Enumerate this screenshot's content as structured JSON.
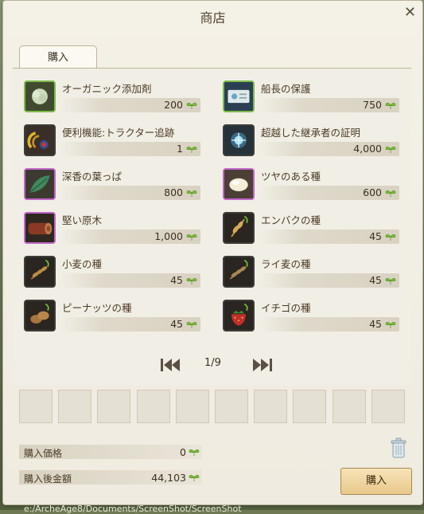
{
  "window": {
    "title": "商店",
    "close_glyph": "✕",
    "tab_label": "購入"
  },
  "items": [
    {
      "name": "オーガニック添加剤",
      "price": "200",
      "icon": "organic-additive-icon",
      "rarity": "green"
    },
    {
      "name": "船長の保護",
      "price": "750",
      "icon": "captain-protection-icon",
      "rarity": "green"
    },
    {
      "name": "便利機能:トラクター追跡",
      "price": "1",
      "icon": "tractor-tracking-icon",
      "rarity": "dark"
    },
    {
      "name": "超越した継承者の証明",
      "price": "4,000",
      "icon": "transcendent-heir-proof-icon",
      "rarity": "dark"
    },
    {
      "name": "深香の葉っぱ",
      "price": "800",
      "icon": "fragrant-leaf-icon",
      "rarity": "purple"
    },
    {
      "name": "ツヤのある種",
      "price": "600",
      "icon": "glossy-seed-icon",
      "rarity": "purple"
    },
    {
      "name": "堅い原木",
      "price": "1,000",
      "icon": "hard-log-icon",
      "rarity": "purple"
    },
    {
      "name": "エンバクの種",
      "price": "45",
      "icon": "oat-seed-icon",
      "rarity": "dark"
    },
    {
      "name": "小麦の種",
      "price": "45",
      "icon": "wheat-seed-icon",
      "rarity": "dark"
    },
    {
      "name": "ライ麦の種",
      "price": "45",
      "icon": "rye-seed-icon",
      "rarity": "dark"
    },
    {
      "name": "ピーナッツの種",
      "price": "45",
      "icon": "peanut-seed-icon",
      "rarity": "dark"
    },
    {
      "name": "イチゴの種",
      "price": "45",
      "icon": "strawberry-seed-icon",
      "rarity": "dark"
    }
  ],
  "pager": {
    "text": "1/9"
  },
  "summary": {
    "price_label": "購入価格",
    "price_value": "0",
    "after_label": "購入後金額",
    "after_value": "44,103"
  },
  "buy_button": "購入",
  "footer_path": "e:/ArcheAge8/Documents/ScreenShot/ScreenShot",
  "colors": {
    "currency_leaf": "#7dbb3c",
    "panel_bg": "#f1eee5",
    "title_text": "#4a3d2a"
  }
}
